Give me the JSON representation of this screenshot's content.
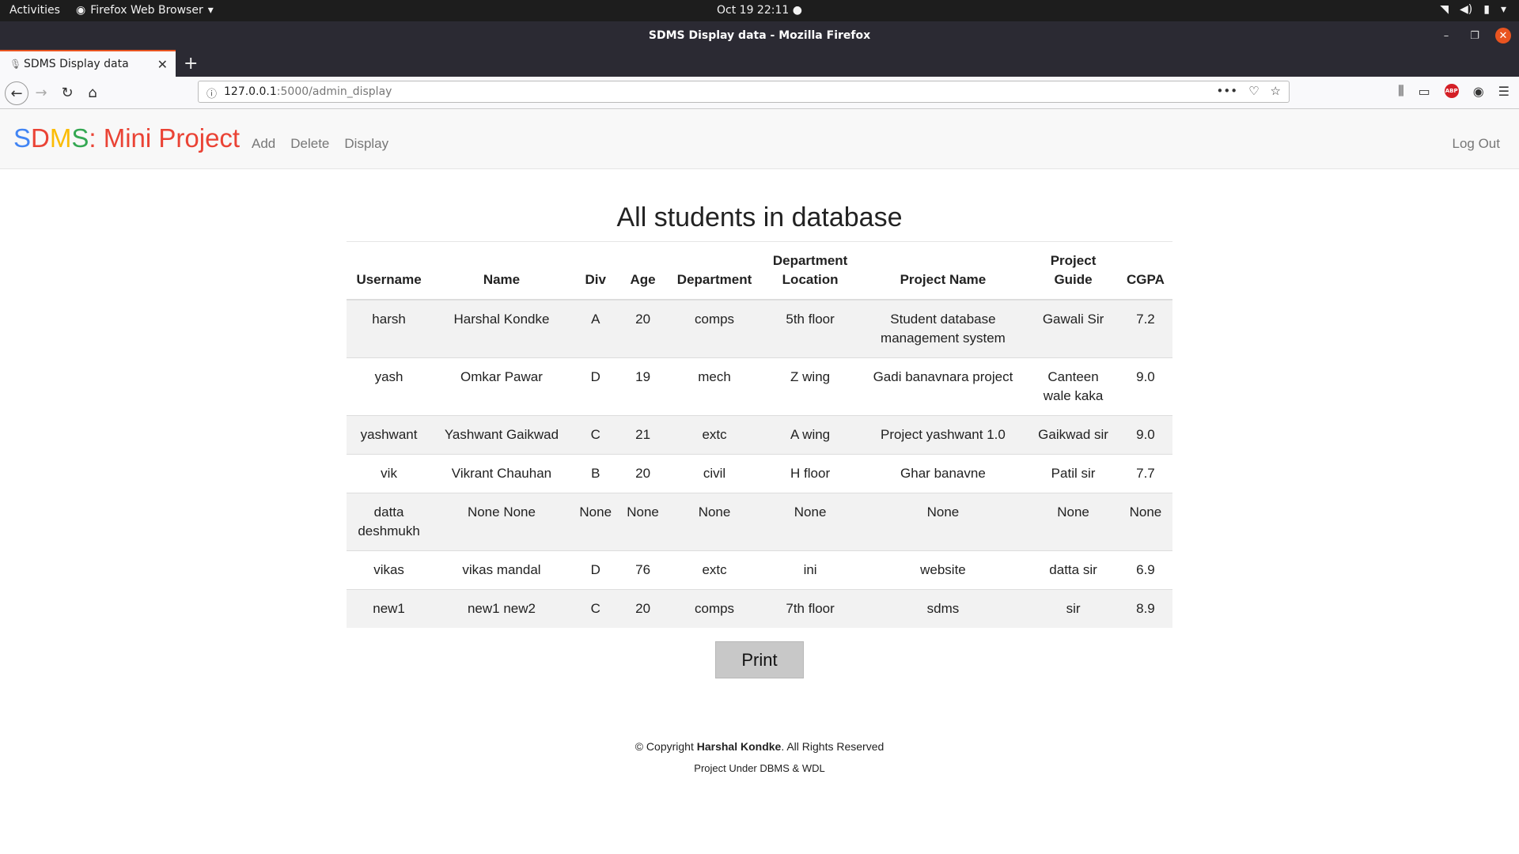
{
  "os": {
    "activities": "Activities",
    "app_menu": "Firefox Web Browser",
    "clock": "Oct 19  22:11"
  },
  "browser": {
    "window_title": "SDMS Display data - Mozilla Firefox",
    "tab_title": "SDMS Display data",
    "url_host": "127.0.0.1",
    "url_path": ":5000/admin_display"
  },
  "site": {
    "brand": {
      "s": "S",
      "d": "D",
      "m": "M",
      "s2": "S",
      "rest": ": Mini Project"
    },
    "nav": [
      "Add",
      "Delete",
      "Display"
    ],
    "logout": "Log Out"
  },
  "main": {
    "heading": "All students in database",
    "print_label": "Print",
    "columns": [
      [
        "Username"
      ],
      [
        "Name"
      ],
      [
        "Div"
      ],
      [
        "Age"
      ],
      [
        "Department"
      ],
      [
        "Department",
        "Location"
      ],
      [
        "Project Name"
      ],
      [
        "Project",
        "Guide"
      ],
      [
        "CGPA"
      ]
    ],
    "rows": [
      [
        [
          "harsh"
        ],
        [
          "Harshal Kondke"
        ],
        [
          "A"
        ],
        [
          "20"
        ],
        [
          "comps"
        ],
        [
          "5th floor"
        ],
        [
          "Student database",
          "management system"
        ],
        [
          "Gawali Sir"
        ],
        [
          "7.2"
        ]
      ],
      [
        [
          "yash"
        ],
        [
          "Omkar Pawar"
        ],
        [
          "D"
        ],
        [
          "19"
        ],
        [
          "mech"
        ],
        [
          "Z wing"
        ],
        [
          "Gadi banavnara project"
        ],
        [
          "Canteen",
          "wale kaka"
        ],
        [
          "9.0"
        ]
      ],
      [
        [
          "yashwant"
        ],
        [
          "Yashwant Gaikwad"
        ],
        [
          "C"
        ],
        [
          "21"
        ],
        [
          "extc"
        ],
        [
          "A wing"
        ],
        [
          "Project yashwant 1.0"
        ],
        [
          "Gaikwad sir"
        ],
        [
          "9.0"
        ]
      ],
      [
        [
          "vik"
        ],
        [
          "Vikrant Chauhan"
        ],
        [
          "B"
        ],
        [
          "20"
        ],
        [
          "civil"
        ],
        [
          "H floor"
        ],
        [
          "Ghar banavne"
        ],
        [
          "Patil sir"
        ],
        [
          "7.7"
        ]
      ],
      [
        [
          "datta",
          "deshmukh"
        ],
        [
          "None None"
        ],
        [
          "None"
        ],
        [
          "None"
        ],
        [
          "None"
        ],
        [
          "None"
        ],
        [
          "None"
        ],
        [
          "None"
        ],
        [
          "None"
        ]
      ],
      [
        [
          "vikas"
        ],
        [
          "vikas mandal"
        ],
        [
          "D"
        ],
        [
          "76"
        ],
        [
          "extc"
        ],
        [
          "ini"
        ],
        [
          "website"
        ],
        [
          "datta sir"
        ],
        [
          "6.9"
        ]
      ],
      [
        [
          "new1"
        ],
        [
          "new1 new2"
        ],
        [
          "C"
        ],
        [
          "20"
        ],
        [
          "comps"
        ],
        [
          "7th floor"
        ],
        [
          "sdms"
        ],
        [
          "sir"
        ],
        [
          "8.9"
        ]
      ]
    ]
  },
  "footer": {
    "copy_prefix": "© Copyright ",
    "author": "Harshal Kondke",
    "copy_suffix": ". All Rights Reserved",
    "line2": "Project Under DBMS & WDL"
  }
}
